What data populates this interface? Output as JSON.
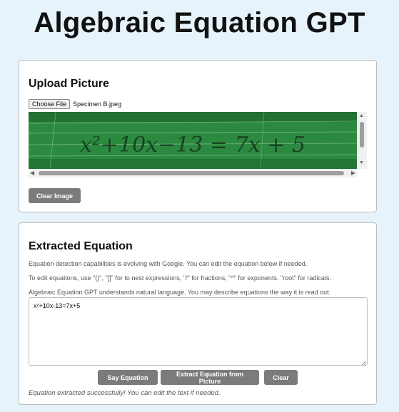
{
  "app": {
    "title": "Algebraic Equation GPT"
  },
  "upload": {
    "heading": "Upload Picture",
    "choose_file_label": "Choose File",
    "file_name": "Specimen B.jpeg",
    "image_equation": "x²+10x−13 = 7x + 5",
    "clear_image_label": "Clear Image"
  },
  "extract": {
    "heading": "Extracted Equation",
    "help_lines": [
      "Equation detection capabilities is evolving with Google. You can edit the equation below if needed.",
      "To edit equations, use \"()\", \"[]\" for to nest expressions, \"/\" for fractions, \"^\" for exponents. \"root\" for radicals.",
      "Algebraic Equation GPT understands natural language. You may describe equations the way it is read out."
    ],
    "equation_value": "x²+10x-13=7x+5",
    "say_label": "Say Equation",
    "extract_label": "Extract Equation from Picture",
    "clear_label": "Clear",
    "status": "Equation extracted successfully! You can edit the text if needed."
  },
  "colors": {
    "background": "#e6f3fb",
    "button": "#7b7b7b",
    "board_green": "#2f9444"
  }
}
